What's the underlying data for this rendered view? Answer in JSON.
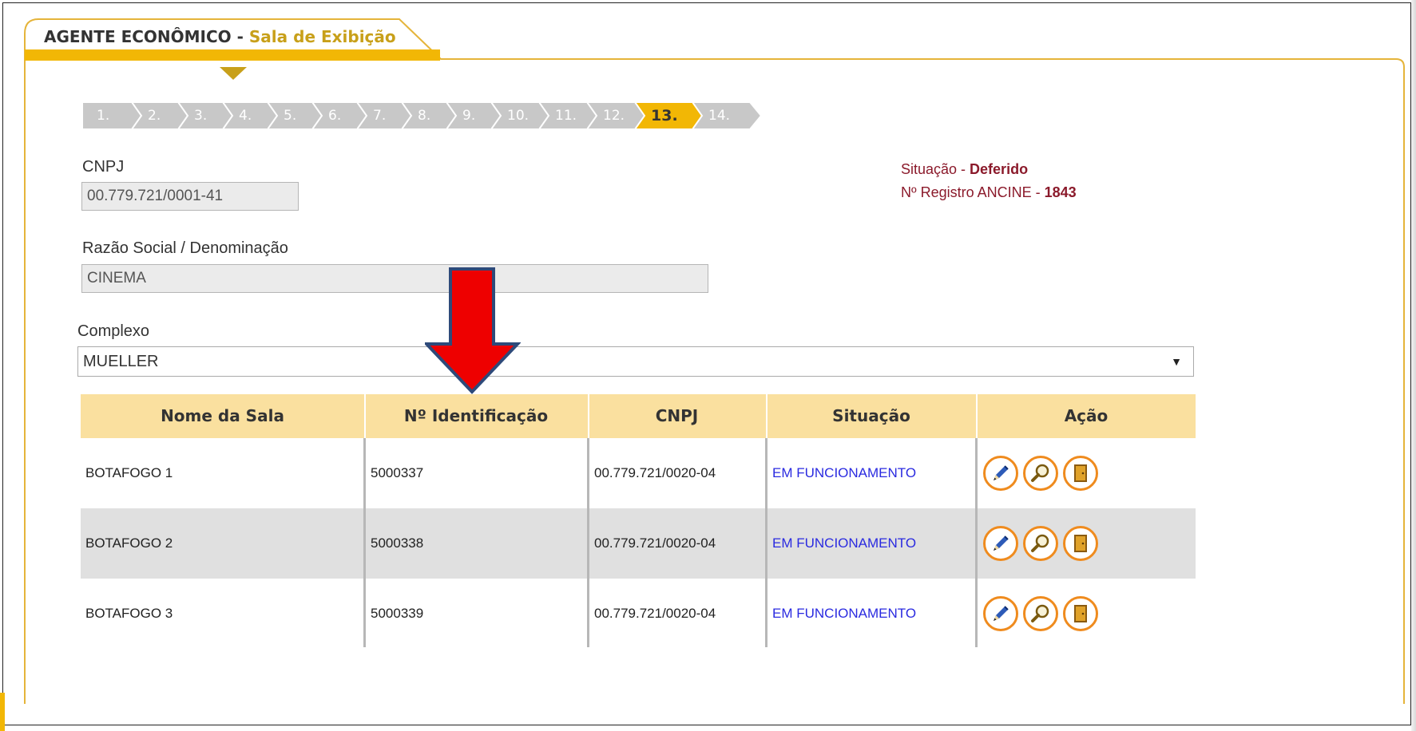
{
  "header": {
    "title": "AGENTE ECONÔMICO - ",
    "subtitle": "Sala de Exibição"
  },
  "steps": [
    {
      "label": "1."
    },
    {
      "label": "2."
    },
    {
      "label": "3."
    },
    {
      "label": "4."
    },
    {
      "label": "5."
    },
    {
      "label": "6."
    },
    {
      "label": "7."
    },
    {
      "label": "8."
    },
    {
      "label": "9."
    },
    {
      "label": "10."
    },
    {
      "label": "11."
    },
    {
      "label": "12."
    },
    {
      "label": "13.",
      "active": true
    },
    {
      "label": "14."
    }
  ],
  "form": {
    "cnpj_label": "CNPJ",
    "cnpj_value": "00.779.721/0001-41",
    "razao_label": "Razão Social / Denominação",
    "razao_value": "CINEMA",
    "complexo_label": "Complexo",
    "complexo_value": "MUELLER"
  },
  "status": {
    "situacao_prefix": "Situação - ",
    "situacao_value": "Deferido",
    "registro_prefix": "Nº Registro ANCINE - ",
    "registro_value": "1843"
  },
  "table": {
    "headers": [
      "Nome da Sala",
      "Nº Identificação",
      "CNPJ",
      "Situação",
      "Ação"
    ],
    "rows": [
      {
        "nome": "BOTAFOGO 1",
        "id": "5000337",
        "cnpj": "00.779.721/0020-04",
        "situacao": "EM FUNCIONAMENTO"
      },
      {
        "nome": "BOTAFOGO 2",
        "id": "5000338",
        "cnpj": "00.779.721/0020-04",
        "situacao": "EM FUNCIONAMENTO"
      },
      {
        "nome": "BOTAFOGO 3",
        "id": "5000339",
        "cnpj": "00.779.721/0020-04",
        "situacao": "EM FUNCIONAMENTO"
      }
    ],
    "action_icons": [
      "pencil-icon",
      "magnifier-icon",
      "door-icon"
    ]
  },
  "colors": {
    "accent": "#f2b705",
    "step_inactive": "#c8c8c8",
    "header_bg": "#fae09f",
    "status_text": "#8b1a2b",
    "link_blue": "#2a2ae0",
    "arrow_red": "#ee0000",
    "arrow_outline": "#2e4a7a"
  }
}
